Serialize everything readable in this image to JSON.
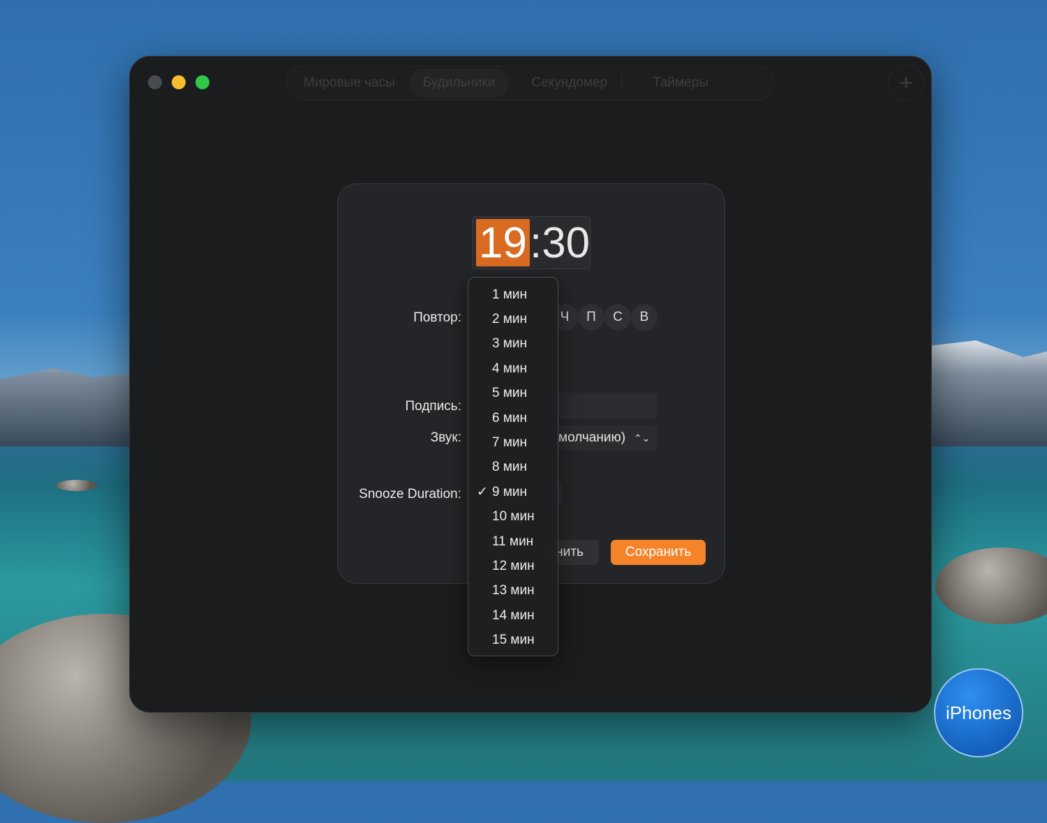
{
  "tabs": [
    {
      "label": "Мировые часы"
    },
    {
      "label": "Будильники"
    },
    {
      "label": "Секундомер"
    },
    {
      "label": "Таймеры"
    }
  ],
  "plus_label": "+",
  "time": {
    "hours": "19",
    "sep_minutes": ":30"
  },
  "labels": {
    "repeat": "Повтор:",
    "caption": "Подпись:",
    "sound": "Звук:",
    "snooze": "Snooze Duration:"
  },
  "days": [
    "Ч",
    "П",
    "С",
    "В"
  ],
  "sound_value": "молчанию)",
  "cancel_label": "нить",
  "save_label": "Сохранить",
  "snooze_options": [
    "1 мин",
    "2 мин",
    "3 мин",
    "4 мин",
    "5 мин",
    "6 мин",
    "7 мин",
    "8 мин",
    "9 мин",
    "10 мин",
    "11 мин",
    "12 мин",
    "13 мин",
    "14 мин",
    "15 мин"
  ],
  "snooze_selected": "9 мин",
  "check": "✓",
  "watermark": "iPhones",
  "colors": {
    "accent": "#f5832a",
    "time_highlight": "#d96a22"
  }
}
